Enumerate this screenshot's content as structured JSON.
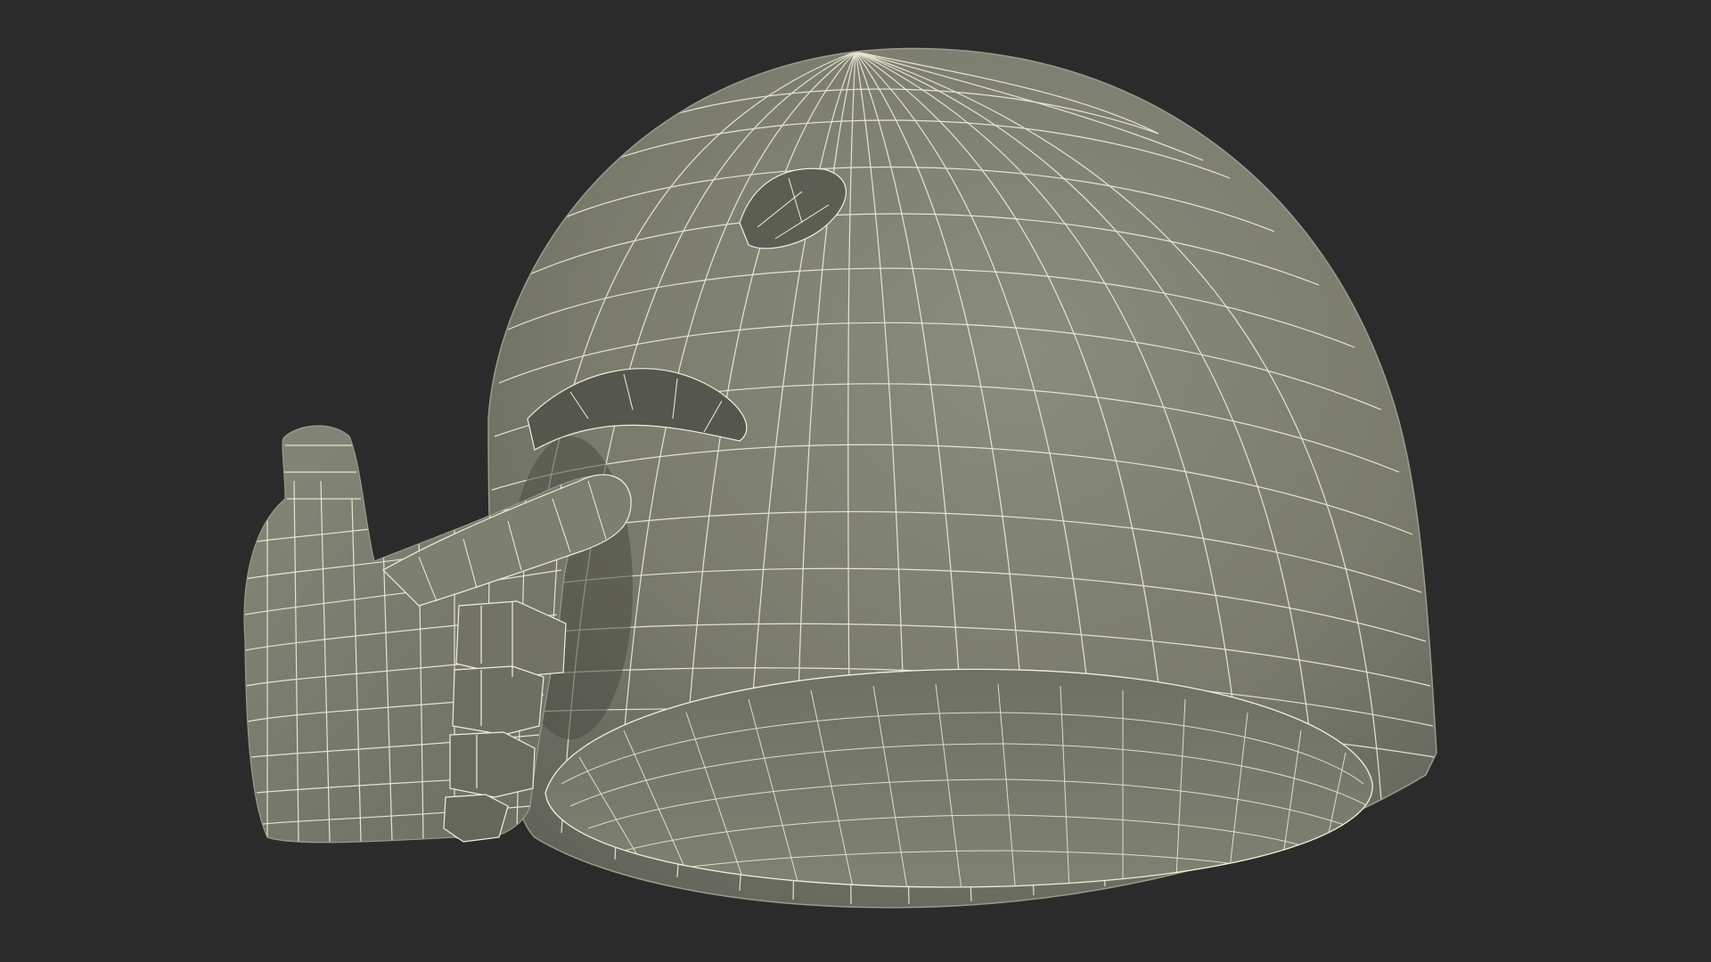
{
  "scene": {
    "subject": "wireframe-helmet-with-hand",
    "colors": {
      "background": "#2b2b2b",
      "surface": "#7a7b6d",
      "surface_light": "#878979",
      "surface_dark": "#5f6055",
      "wire": "#f2f0dc",
      "shadow": "#4a4b43"
    }
  }
}
